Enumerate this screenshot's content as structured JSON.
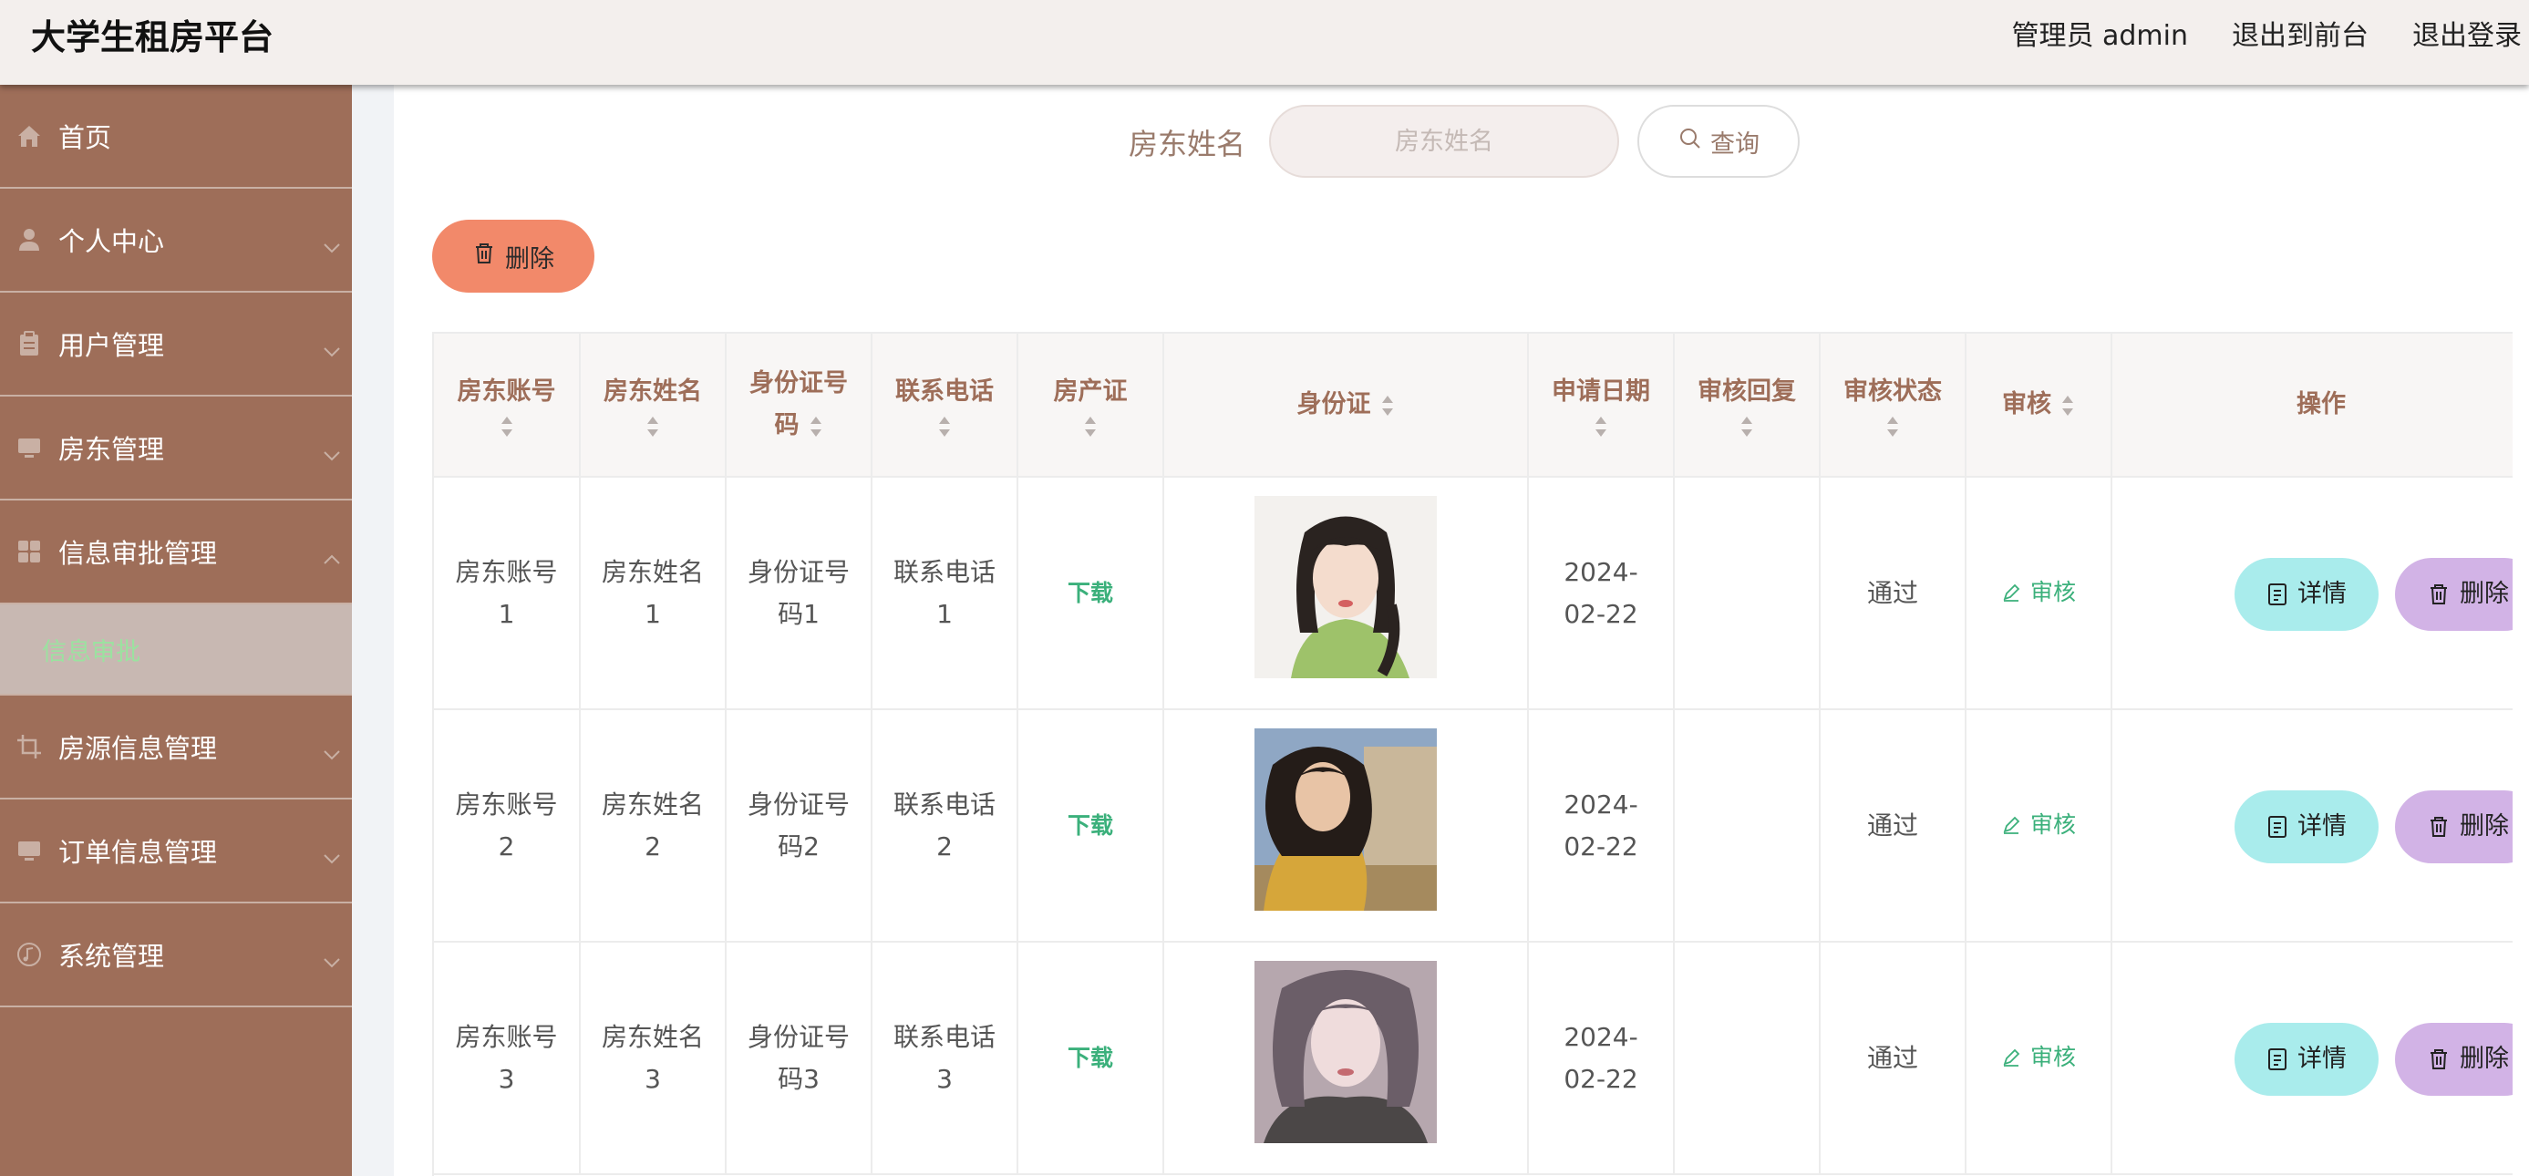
{
  "app": {
    "title": "大学生租房平台"
  },
  "header": {
    "role_label": "管理员 admin",
    "front_link": "退出到前台",
    "logout_link": "退出登录"
  },
  "sidebar": {
    "items": [
      {
        "label": "首页",
        "icon": "home-icon"
      },
      {
        "label": "个人中心",
        "icon": "user-icon"
      },
      {
        "label": "用户管理",
        "icon": "clipboard-icon"
      },
      {
        "label": "房东管理",
        "icon": "monitor-icon"
      },
      {
        "label": "信息审批管理",
        "icon": "grid-icon"
      },
      {
        "label": "房源信息管理",
        "icon": "crop-icon"
      },
      {
        "label": "订单信息管理",
        "icon": "monitor-icon"
      },
      {
        "label": "系统管理",
        "icon": "music-icon"
      }
    ],
    "active_sub": "信息审批"
  },
  "search": {
    "label": "房东姓名",
    "placeholder": "房东姓名",
    "button": "查询"
  },
  "toolbar": {
    "delete_label": "删除"
  },
  "table": {
    "headers": {
      "account": "房东账号",
      "name": "房东姓名",
      "id_no": "身份证号码",
      "phone": "联系电话",
      "deed": "房产证",
      "id_card": "身份证",
      "date": "申请日期",
      "reply": "审核回复",
      "status": "审核状态",
      "audit": "审核",
      "ops": "操作"
    },
    "rows": [
      {
        "account": "房东账号1",
        "name": "房东姓名1",
        "id_no": "身份证号码1",
        "phone": "联系电话1",
        "deed": "下载",
        "date": "2024-02-22",
        "reply": "",
        "status": "通过",
        "audit": "审核",
        "detail": "详情",
        "delete": "删除"
      },
      {
        "account": "房东账号2",
        "name": "房东姓名2",
        "id_no": "身份证号码2",
        "phone": "联系电话2",
        "deed": "下载",
        "date": "2024-02-22",
        "reply": "",
        "status": "通过",
        "audit": "审核",
        "detail": "详情",
        "delete": "删除"
      },
      {
        "account": "房东账号3",
        "name": "房东姓名3",
        "id_no": "身份证号码3",
        "phone": "联系电话3",
        "deed": "下载",
        "date": "2024-02-22",
        "reply": "",
        "status": "通过",
        "audit": "审核",
        "detail": "详情",
        "delete": "删除"
      }
    ]
  },
  "colors": {
    "sidebar": "#9e6e59",
    "accent_orange": "#f2896a",
    "detail_btn": "#a9ecec",
    "delete_btn": "#d2b3e6",
    "link_green": "#3bb07b"
  }
}
